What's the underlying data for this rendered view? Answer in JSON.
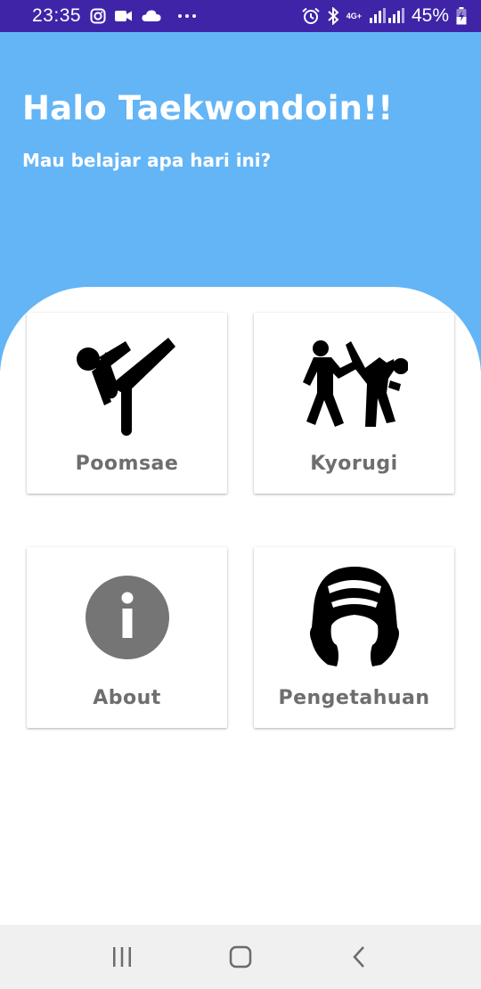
{
  "status_bar": {
    "time": "23:35",
    "battery": "45%",
    "network": "4G+",
    "icons": [
      "instagram-icon",
      "video-camera-icon",
      "cloud-icon",
      "more-dots-icon",
      "alarm-icon",
      "bluetooth-icon",
      "signal-icon",
      "battery-charging-icon"
    ]
  },
  "header": {
    "title": "Halo Taekwondoin!!",
    "subtitle": "Mau belajar apa hari ini?",
    "background_color": "#64b5f6"
  },
  "menu": {
    "items": [
      {
        "label": "Poomsae",
        "icon": "high-kick-icon"
      },
      {
        "label": "Kyorugi",
        "icon": "sparring-icon"
      },
      {
        "label": "About",
        "icon": "info-icon"
      },
      {
        "label": "Pengetahuan",
        "icon": "helmet-icon"
      }
    ]
  },
  "nav": {
    "icons": [
      "recent-apps-icon",
      "home-icon",
      "back-icon"
    ]
  },
  "colors": {
    "status_bar": "#3f24a8",
    "card_label": "#6e6e6e",
    "info_circle": "#757575"
  }
}
